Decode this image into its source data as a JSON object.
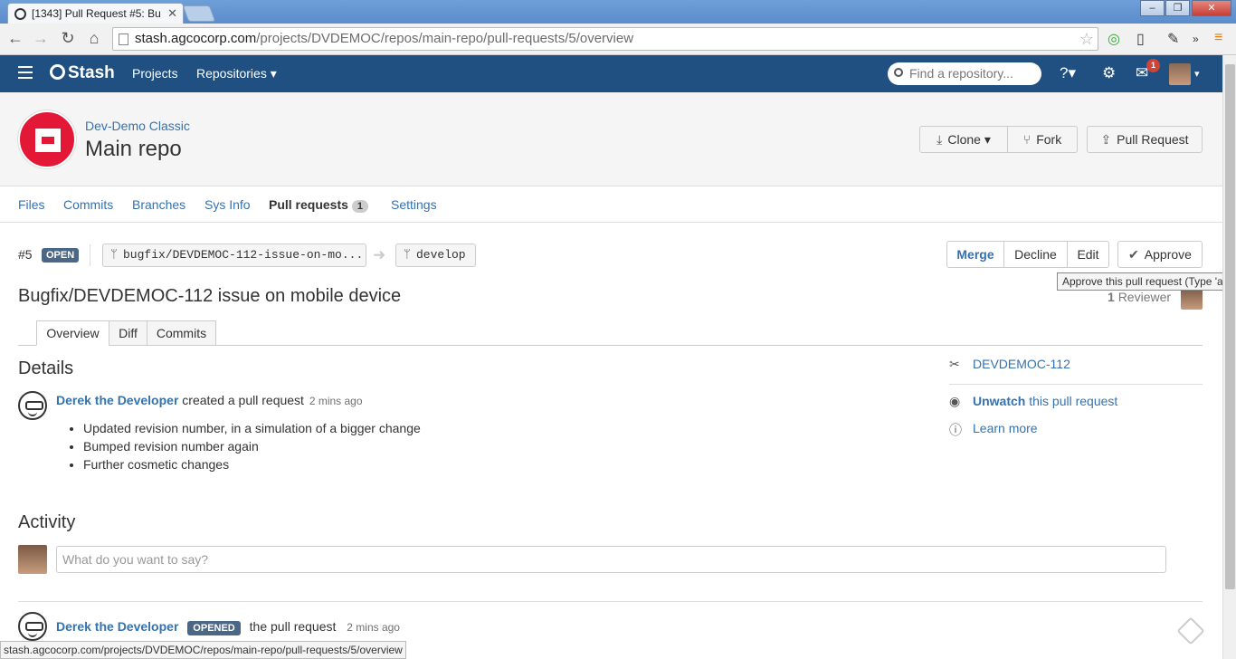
{
  "browser": {
    "tab_title": "[1343] Pull Request #5: Bu",
    "url_host": "stash.agcocorp.com",
    "url_path": "/projects/DVDEMOC/repos/main-repo/pull-requests/5/overview",
    "status_url": "stash.agcocorp.com/projects/DVDEMOC/repos/main-repo/pull-requests/5/overview"
  },
  "header": {
    "logo": "Stash",
    "nav": [
      "Projects",
      "Repositories ▾"
    ],
    "search_placeholder": "Find a repository...",
    "notification_count": "1"
  },
  "repo": {
    "project": "Dev-Demo Classic",
    "name": "Main repo",
    "buttons": {
      "clone": "Clone ▾",
      "fork": "Fork",
      "pull_request": "Pull Request"
    }
  },
  "repo_tabs": {
    "files": "Files",
    "commits": "Commits",
    "branches": "Branches",
    "sysinfo": "Sys Info",
    "pull_requests": "Pull requests",
    "pr_count": "1",
    "settings": "Settings"
  },
  "pr": {
    "id": "#5",
    "state": "OPEN",
    "source_branch": "bugfix/DEVDEMOC-112-issue-on-mo...",
    "target_branch": "develop",
    "title": "Bugfix/DEVDEMOC-112 issue on mobile device",
    "actions": {
      "merge": "Merge",
      "decline": "Decline",
      "edit": "Edit",
      "approve": "Approve"
    },
    "tooltip": "Approve this pull request (Type 'a')",
    "reviewer_count": "1",
    "reviewer_label": "Reviewer",
    "tabs": {
      "overview": "Overview",
      "diff": "Diff",
      "commits": "Commits"
    }
  },
  "details": {
    "heading": "Details",
    "author": "Derek the Developer",
    "action": "created a pull request",
    "time": "2 mins ago",
    "bullets": [
      "Updated revision number, in a simulation of a bigger change",
      "Bumped revision number again",
      "Further cosmetic changes"
    ]
  },
  "sidebar": {
    "issue": "DEVDEMOC-112",
    "unwatch": "Unwatch",
    "unwatch_rest": "this pull request",
    "learn_more": "Learn more"
  },
  "activity": {
    "heading": "Activity",
    "placeholder": "What do you want to say?",
    "entry_author": "Derek the Developer",
    "entry_badge": "OPENED",
    "entry_text": "the pull request",
    "entry_time": "2 mins ago"
  }
}
